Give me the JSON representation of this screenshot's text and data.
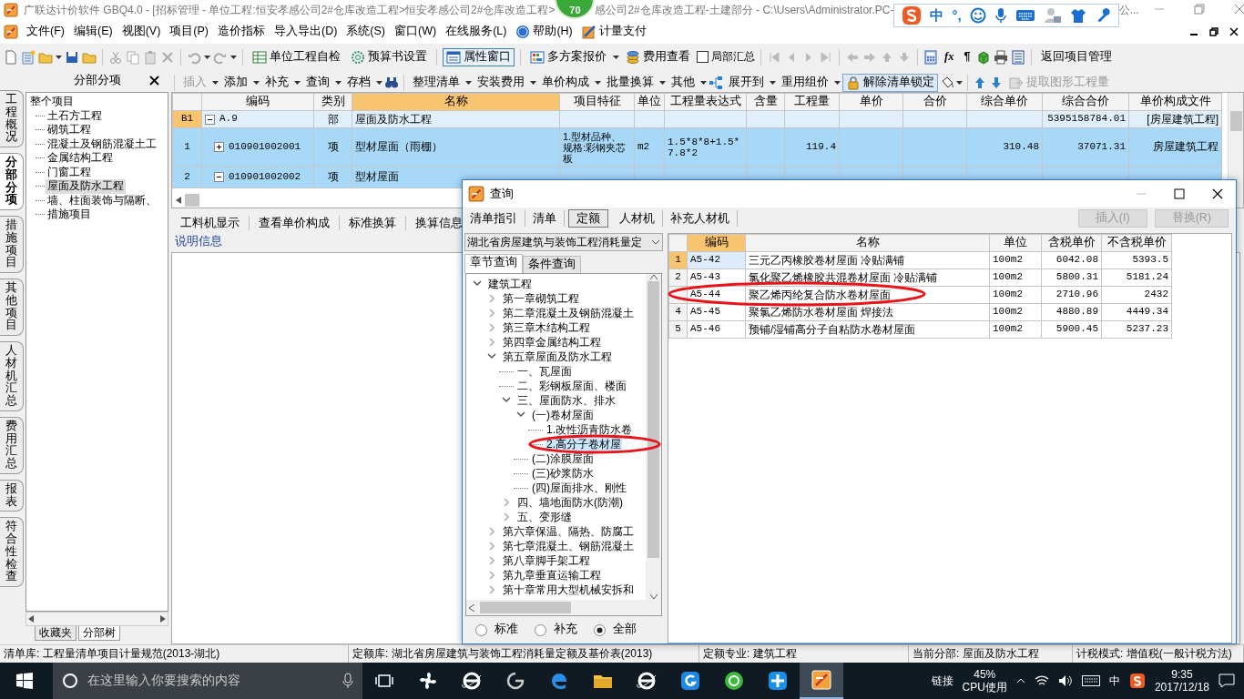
{
  "title_bar": {
    "title_parts": [
      "广联达计价软件 GBQ4.0 - [招标管理 - 单位工程:恒安孝感公司2#仓库改造工程>恒安孝感公司2#仓库改造工程>",
      "感公司2#仓库改造工程-土建部分 - C:\\Users\\Administrator.PC-",
      "公..."
    ],
    "badge": "70",
    "ime_labels": [
      "中",
      "°,"
    ]
  },
  "menu": [
    {
      "label": "文件(F)",
      "kind": "plain"
    },
    {
      "label": "编辑(E)",
      "kind": "plain"
    },
    {
      "label": "视图(V)",
      "kind": "plain"
    },
    {
      "label": "项目(P)",
      "kind": "plain"
    },
    {
      "label": "造价指标",
      "kind": "plain"
    },
    {
      "label": "导入导出(D)",
      "kind": "plain"
    },
    {
      "label": "系统(S)",
      "kind": "plain"
    },
    {
      "label": "窗口(W)",
      "kind": "plain"
    },
    {
      "label": "在线服务(L)",
      "kind": "plain"
    },
    {
      "label": "帮助(H)",
      "kind": "help"
    },
    {
      "label": "计量支付",
      "kind": "pay"
    }
  ],
  "toolbar": {
    "buttons": [
      {
        "label": "单位工程自检",
        "selected": false
      },
      {
        "label": "预算书设置",
        "selected": false
      },
      {
        "label": "属性窗口",
        "selected": true
      },
      {
        "label": "多方案报价",
        "selected": false
      },
      {
        "label": "费用查看",
        "selected": false
      }
    ],
    "checkbox": {
      "label": "局部汇总",
      "checked": false
    },
    "glyphs": [
      "fx",
      "¶"
    ],
    "return_button": "返回项目管理"
  },
  "side_tabs": [
    {
      "label": "工程概况",
      "selected": false
    },
    {
      "label": "分部分项",
      "selected": true
    },
    {
      "label": "措施项目",
      "selected": false
    },
    {
      "label": "其他项目",
      "selected": false
    },
    {
      "label": "人材机汇总",
      "selected": false
    },
    {
      "label": "费用汇总",
      "selected": false
    },
    {
      "label": "报表",
      "selected": false
    },
    {
      "label": "符合性检查",
      "selected": false
    }
  ],
  "left_panel": {
    "title": "分部分项",
    "tree": {
      "label": "整个项目",
      "selected": false,
      "children": [
        {
          "label": "土石方工程",
          "selected": false
        },
        {
          "label": "砌筑工程",
          "selected": false
        },
        {
          "label": "混凝土及钢筋混凝土工",
          "selected": false
        },
        {
          "label": "金属结构工程",
          "selected": false
        },
        {
          "label": "门窗工程",
          "selected": false
        },
        {
          "label": "屋面及防水工程",
          "selected": true
        },
        {
          "label": "墙、柱面装饰与隔断、",
          "selected": false
        },
        {
          "label": "措施项目",
          "selected": false
        }
      ]
    },
    "bottom_tabs": [
      {
        "label": "收藏夹",
        "selected": false
      },
      {
        "label": "分部树",
        "selected": true
      }
    ]
  },
  "edit_toolbar": [
    {
      "label": "插入",
      "kind": "dropdown",
      "disabled": true
    },
    {
      "label": "添加",
      "kind": "dropdown",
      "disabled": false
    },
    {
      "label": "补充",
      "kind": "dropdown",
      "disabled": false
    },
    {
      "label": "查询",
      "kind": "dropdown",
      "disabled": false
    },
    {
      "label": "存档",
      "kind": "dropdown",
      "disabled": false
    },
    {
      "label": "整理清单",
      "kind": "dropdown",
      "disabled": false
    },
    {
      "label": "安装费用",
      "kind": "dropdown",
      "disabled": false
    },
    {
      "label": "单价构成",
      "kind": "dropdown",
      "disabled": false
    },
    {
      "label": "批量换算",
      "kind": "dropdown",
      "disabled": false
    },
    {
      "label": "其他",
      "kind": "dropdown",
      "disabled": false
    },
    {
      "label": "展开到",
      "kind": "dropdown",
      "disabled": false
    },
    {
      "label": "重用组价",
      "kind": "dropdown",
      "disabled": false
    },
    {
      "label": "解除清单锁定",
      "kind": "framed",
      "disabled": false
    },
    {
      "label": "提取图形工程量",
      "kind": "button",
      "disabled": true
    }
  ],
  "grid": {
    "columns": [
      {
        "label": "编码",
        "selected": false
      },
      {
        "label": "类别",
        "selected": false
      },
      {
        "label": "名称",
        "selected": true
      },
      {
        "label": "项目特征",
        "selected": false
      },
      {
        "label": "单位",
        "selected": false
      },
      {
        "label": "工程量表达式",
        "selected": false
      },
      {
        "label": "含量",
        "selected": false
      },
      {
        "label": "工程量",
        "selected": false
      },
      {
        "label": "单价",
        "selected": false
      },
      {
        "label": "合价",
        "selected": false
      },
      {
        "label": "综合单价",
        "selected": false
      },
      {
        "label": "综合合价",
        "selected": false
      },
      {
        "label": "单价构成文件",
        "selected": false
      }
    ],
    "rows": [
      {
        "header": "B1",
        "kind": "section",
        "current": true,
        "selected": false,
        "expanded": true,
        "code": "A.9",
        "category": "部",
        "name": "屋面及防水工程",
        "composite_total": "5395158784.01",
        "price_file": "[房屋建筑工程]"
      },
      {
        "header": "1",
        "kind": "item",
        "current": false,
        "selected": true,
        "expanded": false,
        "code": "010901002001",
        "category": "项",
        "name": "型材屋面（雨棚）",
        "features": "1.型材品种、规格:彩钢夹芯板",
        "unit": "m2",
        "quantity_expression": "1.5*8*8+1.5*7.8*2",
        "quantity": "119.4",
        "composite_unit_price": "310.48",
        "composite_total": "37071.31",
        "price_file": "房屋建筑工程"
      },
      {
        "header": "2",
        "kind": "item",
        "current": false,
        "selected": true,
        "expanded": true,
        "code": "010901002002",
        "category": "项",
        "name": "型材屋面"
      }
    ]
  },
  "detail_tabs": [
    {
      "label": "工料机显示"
    },
    {
      "label": "查看单价构成"
    },
    {
      "label": "标准换算"
    },
    {
      "label": "换算信息"
    }
  ],
  "detail_title": "说明信息",
  "dialog": {
    "title": "查询",
    "tabs": [
      {
        "label": "清单指引",
        "selected": false
      },
      {
        "label": "清单",
        "selected": false
      },
      {
        "label": "定额",
        "selected": true
      },
      {
        "label": "人材机",
        "selected": false
      },
      {
        "label": "补充人材机",
        "selected": false
      }
    ],
    "buttons": [
      {
        "label": "插入(I)",
        "disabled": true
      },
      {
        "label": "替换(R)",
        "disabled": true
      }
    ],
    "library": "湖北省房屋建筑与装饰工程消耗量定",
    "sub_tabs": [
      {
        "label": "章节查询",
        "selected": true
      },
      {
        "label": "条件查询",
        "selected": false
      }
    ],
    "tree": [
      {
        "label": "建筑工程",
        "expanded": true,
        "selected": false,
        "children": [
          {
            "label": "第一章砌筑工程",
            "expanded": false,
            "selected": false
          },
          {
            "label": "第二章混凝土及钢筋混凝土",
            "expanded": false,
            "selected": false
          },
          {
            "label": "第三章木结构工程",
            "expanded": false,
            "selected": false
          },
          {
            "label": "第四章金属结构工程",
            "expanded": false,
            "selected": false
          },
          {
            "label": "第五章屋面及防水工程",
            "expanded": true,
            "selected": false,
            "children": [
              {
                "label": "一、瓦屋面",
                "selected": false
              },
              {
                "label": "二、彩钢板屋面、楼面",
                "selected": false
              },
              {
                "label": "三、屋面防水、排水",
                "expanded": true,
                "selected": false,
                "children": [
                  {
                    "label": "(一)卷材屋面",
                    "expanded": true,
                    "selected": false,
                    "children": [
                      {
                        "label": "1.改性沥青防水卷",
                        "selected": false
                      },
                      {
                        "label": "2.高分子卷材屋",
                        "selected": true
                      }
                    ]
                  },
                  {
                    "label": "(二)涂膜屋面",
                    "selected": false
                  },
                  {
                    "label": "(三)砂浆防水",
                    "selected": false
                  },
                  {
                    "label": "(四)屋面排水、刚性",
                    "selected": false
                  }
                ]
              },
              {
                "label": "四、墙地面防水(防潮)",
                "expanded": false,
                "selected": false
              },
              {
                "label": "五、变形缝",
                "expanded": false,
                "selected": false
              }
            ]
          },
          {
            "label": "第六章保温、隔热、防腐工",
            "expanded": false,
            "selected": false
          },
          {
            "label": "第七章混凝土、钢筋混凝土",
            "expanded": false,
            "selected": false
          },
          {
            "label": "第八章脚手架工程",
            "expanded": false,
            "selected": false
          },
          {
            "label": "第九章垂直运输工程",
            "expanded": false,
            "selected": false
          },
          {
            "label": "第十章常用大型机械安拆和",
            "expanded": false,
            "selected": false
          }
        ]
      }
    ],
    "filters": [
      {
        "label": "标准",
        "selected": false
      },
      {
        "label": "补充",
        "selected": false
      },
      {
        "label": "全部",
        "selected": true
      }
    ],
    "table": {
      "columns": [
        {
          "label": "编码",
          "selected": true
        },
        {
          "label": "名称",
          "selected": false
        },
        {
          "label": "单位",
          "selected": false
        },
        {
          "label": "含税单价",
          "selected": false
        },
        {
          "label": "不含税单价",
          "selected": false
        }
      ],
      "rows": [
        {
          "index": "1",
          "code": "A5-42",
          "name": "三元乙丙橡胶卷材屋面 冷贴满铺",
          "unit": "100m2",
          "price_with_tax": "6042.08",
          "price_without_tax": "5393.5",
          "selected": true
        },
        {
          "index": "2",
          "code": "A5-43",
          "name": "氯化聚乙烯橡胶共混卷材屋面 冷贴满铺",
          "unit": "100m2",
          "price_with_tax": "5800.31",
          "price_without_tax": "5181.24",
          "selected": false
        },
        {
          "code": "A5-44",
          "name": "聚乙烯丙纶复合防水卷材屋面",
          "unit": "100m2",
          "price_with_tax": "2710.96",
          "price_without_tax": "2432",
          "selected": false
        },
        {
          "index": "4",
          "code": "A5-45",
          "name": "聚氯乙烯防水卷材屋面 焊接法",
          "unit": "100m2",
          "price_with_tax": "4880.89",
          "price_without_tax": "4449.34",
          "selected": false
        },
        {
          "index": "5",
          "code": "A5-46",
          "name": "预铺/湿铺高分子自粘防水卷材屋面",
          "unit": "100m2",
          "price_with_tax": "5900.45",
          "price_without_tax": "5237.23",
          "selected": false
        }
      ]
    }
  },
  "status_bar": [
    "清单库: 工程量清单项目计量规范(2013-湖北)",
    "定额库: 湖北省房屋建筑与装饰工程消耗量定额及基价表(2013)",
    "定额专业: 建筑工程",
    "当前分部: 屋面及防水工程",
    "计税模式: 增值税(一般计税方法)"
  ],
  "taskbar": {
    "search": {
      "placeholder": "在这里输入你要搜索的内容"
    },
    "apps": [
      {
        "kind": "fan",
        "active": false
      },
      {
        "kind": "ie",
        "active": false
      },
      {
        "kind": "spiral",
        "active": false
      },
      {
        "kind": "edge",
        "active": false
      },
      {
        "kind": "folder",
        "active": false
      },
      {
        "kind": "ie",
        "active": false
      },
      {
        "kind": "g",
        "active": false
      },
      {
        "kind": "green",
        "active": false
      },
      {
        "kind": "plus",
        "active": false
      },
      {
        "kind": "gbq",
        "active": true
      }
    ],
    "links": "链接",
    "cpu": "45%",
    "cpu_label": "CPU使用",
    "ime": "中",
    "time": "9:35",
    "date": "2017/12/18"
  }
}
